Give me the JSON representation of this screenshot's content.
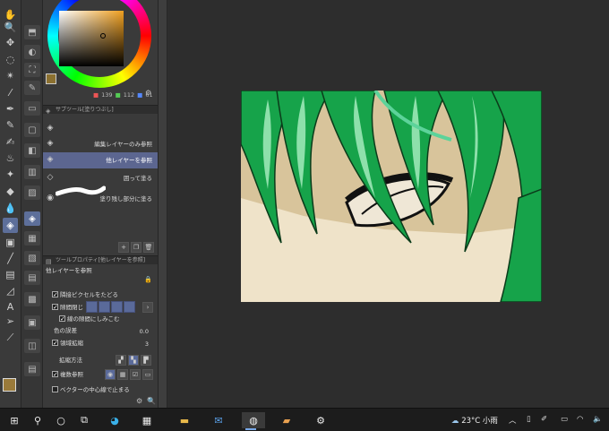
{
  "colors": {
    "foreground": "#9a7a3a",
    "accent_selection": "#5c6690",
    "canvas_bg": "#2d2d2d"
  },
  "toolbar": {
    "tools": [
      {
        "name": "hand-icon",
        "glyph": "✋"
      },
      {
        "name": "zoom-icon",
        "glyph": "🔍"
      },
      {
        "name": "move-icon",
        "glyph": "✥"
      },
      {
        "name": "lasso-icon",
        "glyph": "◌"
      },
      {
        "name": "magic-wand-icon",
        "glyph": "✴"
      },
      {
        "name": "eyedropper-icon",
        "glyph": "⁄"
      },
      {
        "name": "pen-icon",
        "glyph": "✒"
      },
      {
        "name": "pencil-icon",
        "glyph": "✎"
      },
      {
        "name": "brush-icon",
        "glyph": "✍"
      },
      {
        "name": "airbrush-icon",
        "glyph": "♨"
      },
      {
        "name": "decoration-icon",
        "glyph": "✦"
      },
      {
        "name": "eraser-icon",
        "glyph": "◆"
      },
      {
        "name": "blend-icon",
        "glyph": "💧"
      },
      {
        "name": "fill-icon",
        "glyph": "◈"
      },
      {
        "name": "gradient-icon",
        "glyph": "▣"
      },
      {
        "name": "figure-icon",
        "glyph": "╱"
      },
      {
        "name": "frame-icon",
        "glyph": "▤"
      },
      {
        "name": "ruler-icon",
        "glyph": "◿"
      },
      {
        "name": "text-icon",
        "glyph": "A"
      },
      {
        "name": "balloon-icon",
        "glyph": "➢"
      },
      {
        "name": "correct-line-icon",
        "glyph": "⟋"
      }
    ]
  },
  "color_panel": {
    "red": "139",
    "green": "112",
    "blue": "61"
  },
  "subtool_panel": {
    "header": "サブツール[塗りつぶし]",
    "items": [
      {
        "label": "編集レイヤーのみ参照"
      },
      {
        "label": "他レイヤーを参照"
      },
      {
        "label": "囲って塗る"
      },
      {
        "label": "塗り残し部分に塗る"
      }
    ]
  },
  "tool_property": {
    "header": "ツールプロパティ[他レイヤーを参照]",
    "subtitle": "他レイヤーを参照",
    "adjacent_pixels": "隣接ピクセルをたどる",
    "close_gap": "隙間閉じ",
    "fill_lines": "線の隙間にしみこむ",
    "color_margin": "色の誤差",
    "color_margin_value": "0.0",
    "expand": "領域拡縮",
    "expand_value": "3",
    "expand_method": "拡縮方法",
    "multiple_refer": "複数参照",
    "vector_center": "ベクターの中心線で止まる"
  },
  "taskbar": {
    "weather_temp": "23°C",
    "weather_desc": "小雨"
  }
}
